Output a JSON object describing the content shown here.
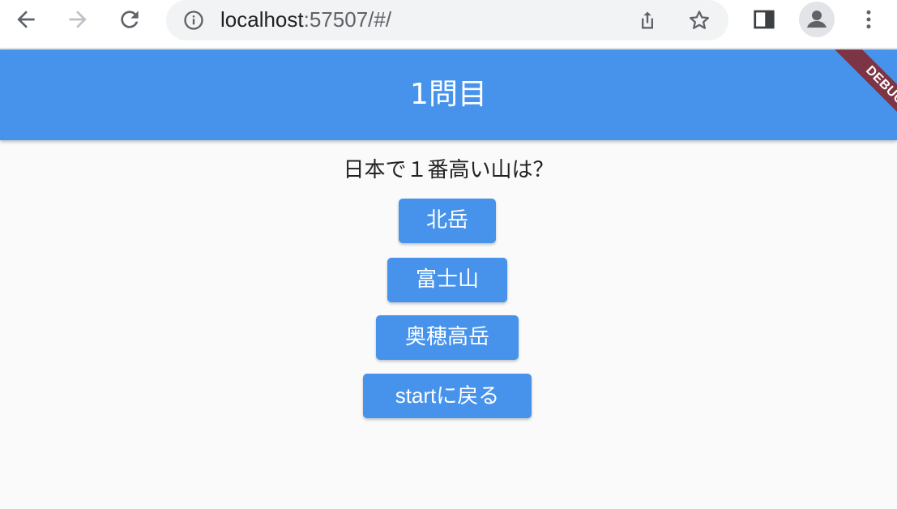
{
  "browser": {
    "url_host": "localhost",
    "url_rest": ":57507/#/",
    "icons": [
      "back-arrow-icon",
      "forward-arrow-icon",
      "reload-icon",
      "info-icon",
      "share-icon",
      "star-icon",
      "side-panel-icon",
      "profile-icon",
      "more-menu-icon"
    ]
  },
  "app_bar": {
    "title": "1問目",
    "color": "#4793ec"
  },
  "debug_banner": {
    "label": "DEBUG",
    "color": "#7d3444"
  },
  "quiz": {
    "question": "日本で１番高い山は？",
    "answers": [
      "北岳",
      "富士山",
      "奥穂高岳"
    ],
    "back_button": "startに戻る"
  }
}
